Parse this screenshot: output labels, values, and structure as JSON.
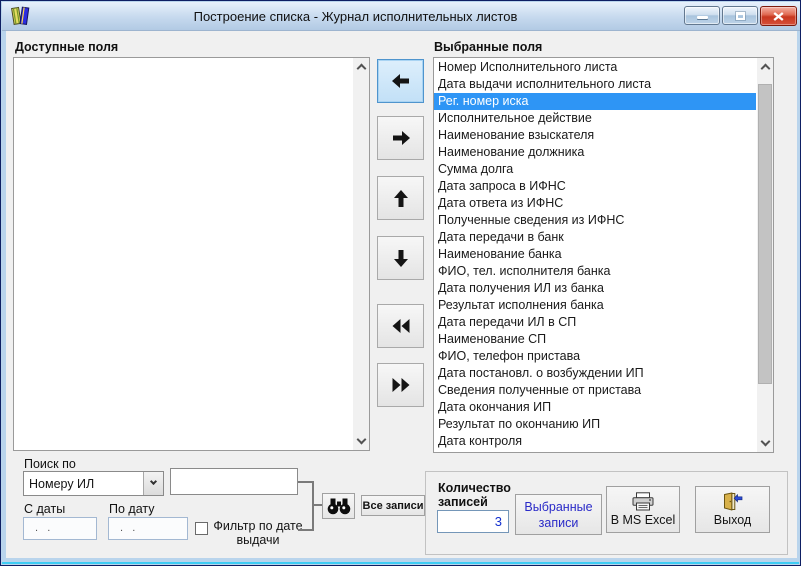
{
  "window": {
    "title": "Построение списка - Журнал исполнительных листов"
  },
  "available_fields": {
    "label": "Доступные поля",
    "items": []
  },
  "selected_fields": {
    "label": "Выбранные поля",
    "selected_index": 2,
    "items": [
      "Номер Исполнительного листа",
      "Дата выдачи исполнительного листа",
      "Рег. номер иска",
      "Исполнительное действие",
      "Наименование взыскателя",
      "Наименование должника",
      "Сумма долга",
      "Дата запроса в ИФНС",
      "Дата ответа из ИФНС",
      "Полученные сведения из ИФНС",
      "Дата передачи в банк",
      "Наименование банка",
      "ФИО, тел. исполнителя банка",
      "Дата получения ИЛ из банка",
      "Результат исполнения банка",
      "Дата передачи ИЛ в СП",
      "Наименование СП",
      "ФИО, телефон пристава",
      "Дата постановл. о возбуждении ИП",
      "Сведения полученные от пристава",
      "Дата окончания ИП",
      "Результат по окончанию ИП",
      "Дата контроля"
    ]
  },
  "search": {
    "label": "Поиск по",
    "field_select_value": "Номеру ИЛ",
    "query_value": "",
    "date_from_label": "С даты",
    "date_to_label": "По дату",
    "date_from_value": " .  . ",
    "date_to_value": " .  . ",
    "filter_label": "Фильтр по дате выдачи",
    "filter_checked": false,
    "all_records_label": "Все записи"
  },
  "footer": {
    "count_label": "Количество записей",
    "count_value": "3",
    "selected_records_label": "Выбранные записи",
    "excel_label": "В MS Excel",
    "exit_label": "Выход"
  },
  "colors": {
    "selection_bg": "#2e95f5",
    "selection_text": "#ffffff",
    "link_blue": "#2a2ac8",
    "count_blue": "#1330cf",
    "titlebar_top": "#e7f1fb",
    "titlebar_bottom": "#b2cae4",
    "close_red": "#c8371f",
    "focused_button_border": "#4f94cd"
  }
}
